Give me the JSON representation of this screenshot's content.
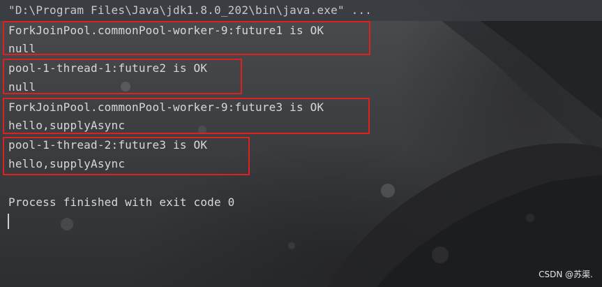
{
  "console": {
    "command": "\"D:\\Program Files\\Java\\jdk1.8.0_202\\bin\\java.exe\" ...",
    "output_lines": [
      "ForkJoinPool.commonPool-worker-9:future1 is OK",
      "null",
      "pool-1-thread-1:future2 is OK",
      "null",
      "ForkJoinPool.commonPool-worker-9:future3 is OK",
      "hello,supplyAsync",
      "pool-1-thread-2:future3 is OK",
      "hello,supplyAsync",
      "",
      "Process finished with exit code 0"
    ]
  },
  "watermark": "CSDN @苏渠.",
  "colors": {
    "highlight_box": "#e02020",
    "text": "#d8d8d8",
    "background": "#3f4145"
  }
}
